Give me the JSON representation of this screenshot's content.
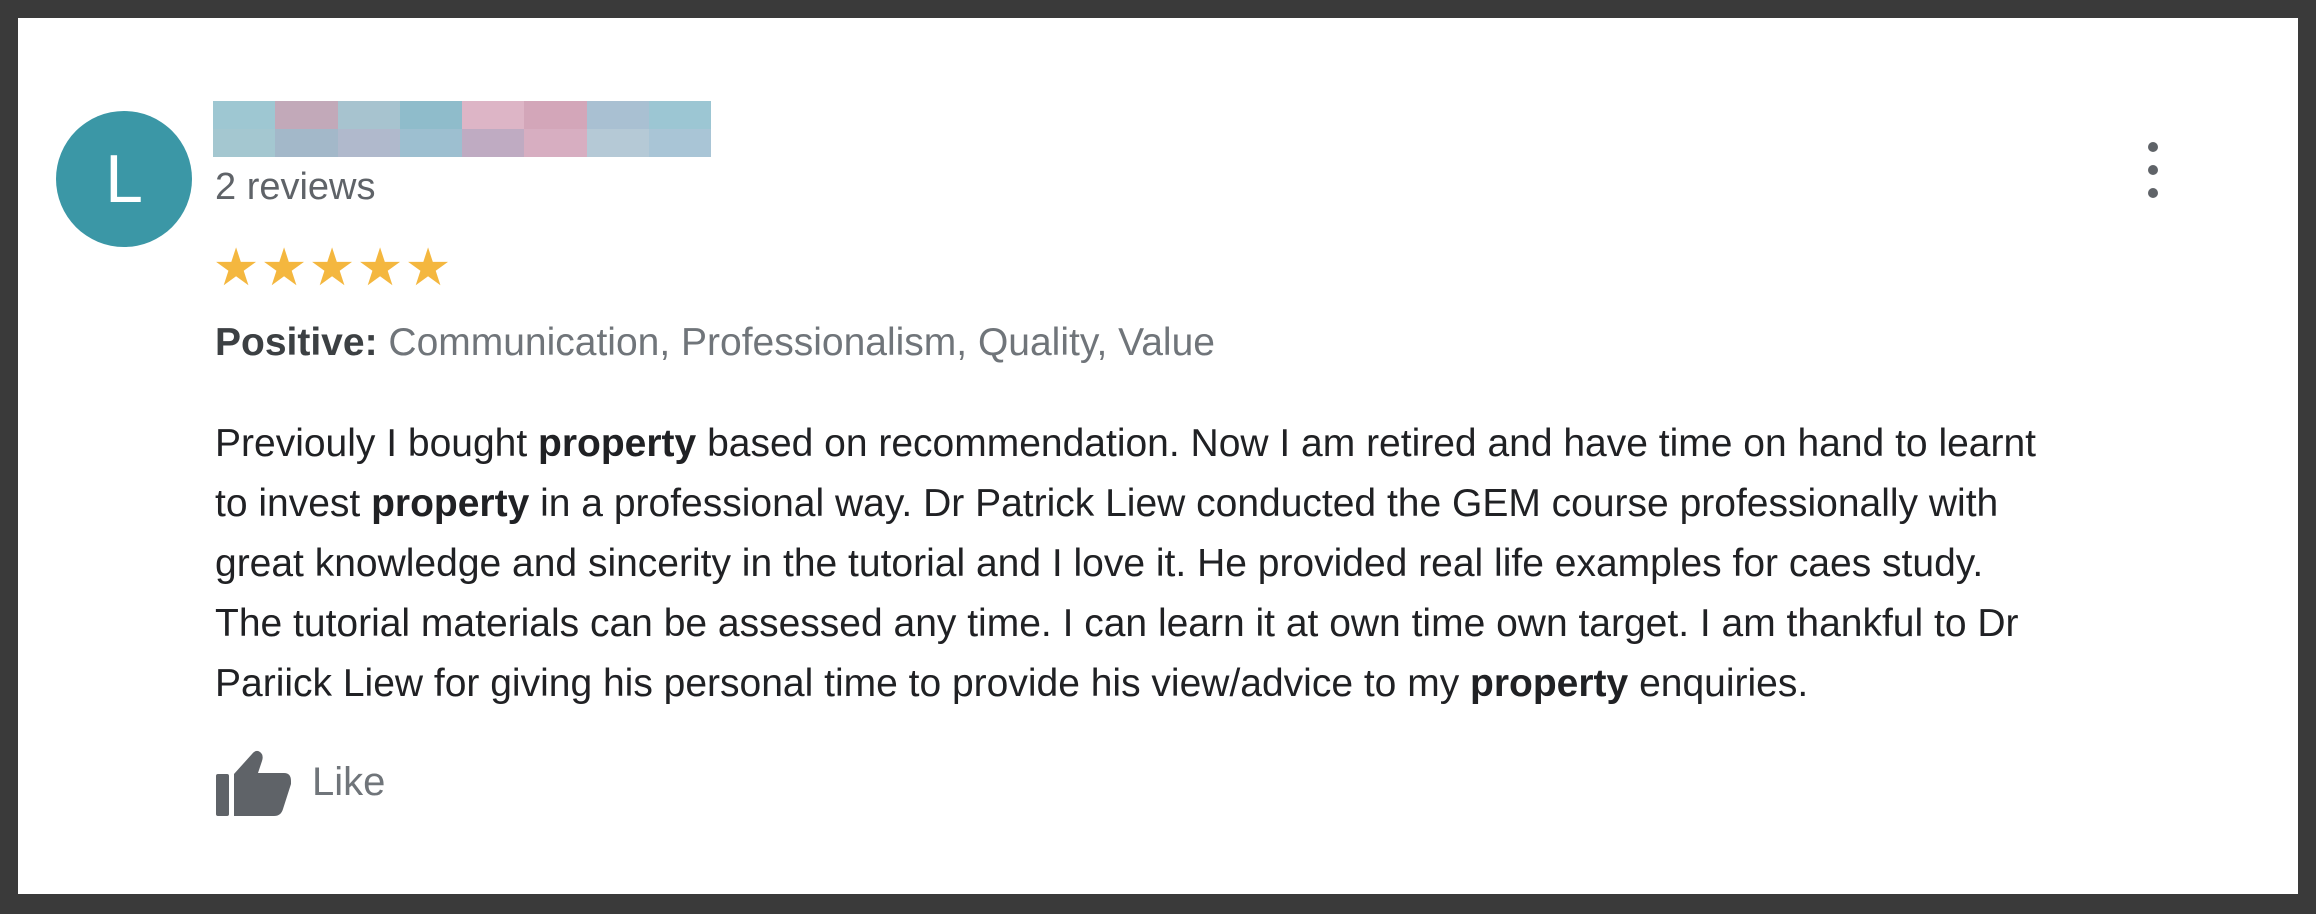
{
  "reviewer": {
    "avatar_letter": "L",
    "avatar_color": "#3b97a6",
    "review_count": "2 reviews"
  },
  "rating": {
    "stars": 5,
    "max": 5,
    "star_color": "#f4b73f"
  },
  "highlights": {
    "label": "Positive:",
    "values": "Communication, Professionalism, Quality, Value"
  },
  "review": {
    "lines": [
      [
        "Previouly I bought ",
        {
          "b": "property"
        },
        " based on recommendation. Now I am retired and have time on hand to learnt"
      ],
      [
        "to invest ",
        {
          "b": "property"
        },
        " in a professional way. Dr Patrick Liew conducted the GEM course professionally with"
      ],
      [
        "great knowledge and sincerity in the tutorial and I love it. He provided real life examples for caes study."
      ],
      [
        "The tutorial materials can be assessed any time. I can learn it at own time own target. I am thankful to Dr"
      ],
      [
        "Pariick Liew for giving his personal time to provide his view/advice to my ",
        {
          "b": "property"
        },
        " enquiries."
      ]
    ]
  },
  "actions": {
    "like_label": "Like",
    "like_icon": "thumbs-up-icon",
    "menu_icon": "more-vert-icon"
  }
}
